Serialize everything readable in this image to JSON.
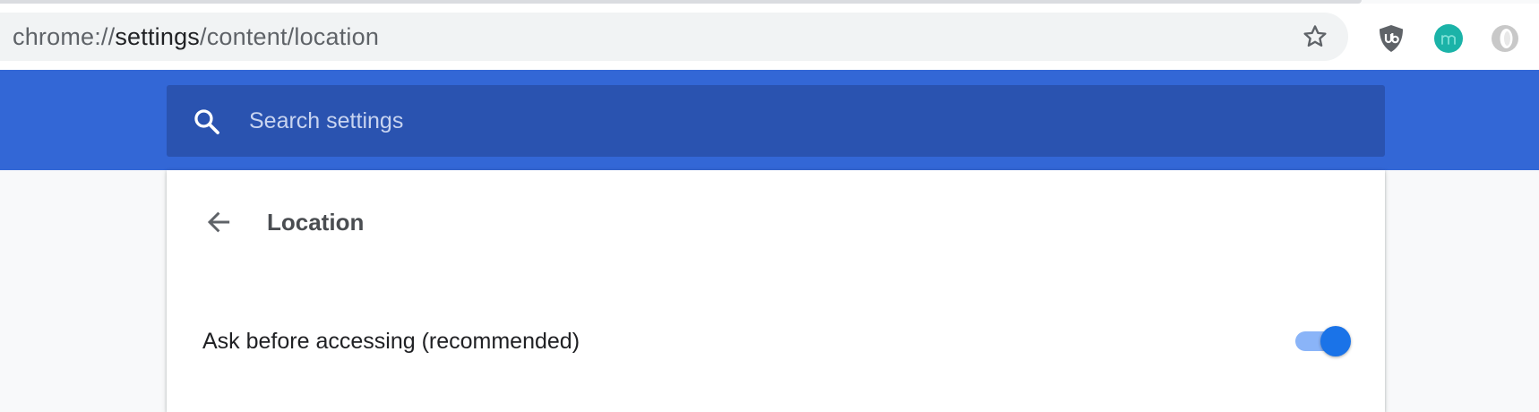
{
  "browser": {
    "url_scheme": "chrome://",
    "url_host": "settings",
    "url_path": "/content/location",
    "icons": {
      "bookmark": "star-icon",
      "extension_1": "ublock-shield-icon",
      "extension_2": "m-avatar-icon",
      "extension_3": "opera-icon"
    },
    "colors": {
      "ublock": "#5f6368",
      "m_avatar": "#1bb3a8"
    }
  },
  "settings_header": {
    "search_placeholder": "Search settings",
    "search_value": "",
    "icon": "search-icon",
    "colors": {
      "band": "#3367d6",
      "search_bg": "#2a53b0"
    }
  },
  "page": {
    "title": "Location",
    "back_icon": "arrow-back-icon",
    "settings": [
      {
        "label": "Ask before accessing (recommended)",
        "enabled": true
      }
    ],
    "colors": {
      "toggle_on": "#1a73e8",
      "toggle_track_on": "#8ab4f8"
    }
  }
}
